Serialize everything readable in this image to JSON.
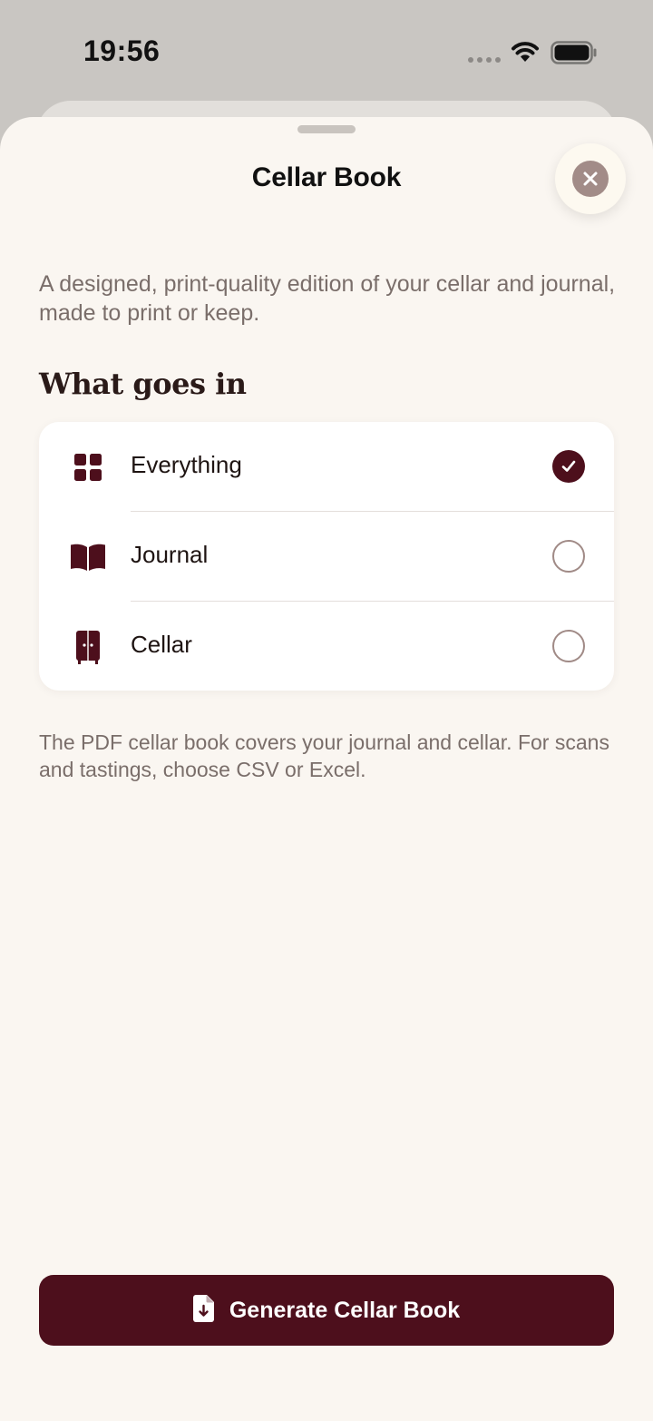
{
  "status_bar": {
    "time": "19:56"
  },
  "sheet": {
    "title": "Cellar Book",
    "close_icon": "close-icon",
    "intro": "A designed, print-quality edition of your cellar and journal, made to print or keep.",
    "section_heading": "What goes in",
    "options": [
      {
        "label": "Everything",
        "icon": "grid-icon",
        "selected": true
      },
      {
        "label": "Journal",
        "icon": "open-book-icon",
        "selected": false
      },
      {
        "label": "Cellar",
        "icon": "cabinet-icon",
        "selected": false
      }
    ],
    "footnote": "The PDF cellar book covers your journal and cellar. For scans and tastings, choose CSV or Excel.",
    "primary_button": {
      "label": "Generate Cellar Book",
      "icon": "document-download-icon"
    }
  },
  "colors": {
    "accent": "#4d0f1c",
    "sheet_background": "#faf6f1",
    "muted_text": "#7a6e6a"
  }
}
